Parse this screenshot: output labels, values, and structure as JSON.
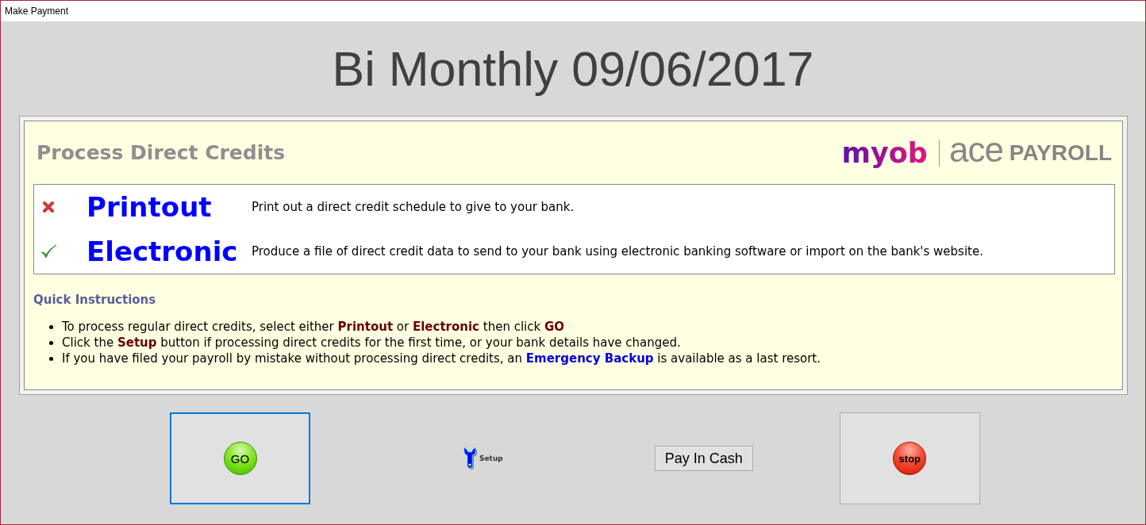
{
  "window": {
    "title": "Make Payment"
  },
  "heading": "Bi Monthly 09/06/2017",
  "panel": {
    "title": "Process Direct Credits",
    "logo": {
      "brand": "myob",
      "product": "ace",
      "product_suffix": "PAYROLL"
    },
    "options": [
      {
        "label": "Printout",
        "description": "Print out a direct credit schedule to give to your bank.",
        "checked": false
      },
      {
        "label": "Electronic",
        "description": "Produce a file of direct credit data to send to your bank using electronic banking software or import on the bank's website.",
        "checked": true
      }
    ],
    "instructions": {
      "title": "Quick Instructions",
      "items": [
        [
          {
            "text": "To process regular direct credits, select either ",
            "kind": "text"
          },
          {
            "text": "Printout",
            "kind": "keyword"
          },
          {
            "text": " or ",
            "kind": "text"
          },
          {
            "text": "Electronic",
            "kind": "keyword"
          },
          {
            "text": " then click ",
            "kind": "text"
          },
          {
            "text": "GO",
            "kind": "keyword"
          }
        ],
        [
          {
            "text": "Click the ",
            "kind": "text"
          },
          {
            "text": "Setup",
            "kind": "keyword"
          },
          {
            "text": " button if processing direct credits for the first time, or your bank details have changed.",
            "kind": "text"
          }
        ],
        [
          {
            "text": "If you have filed your payroll by mistake without processing direct credits, an ",
            "kind": "text"
          },
          {
            "text": "Emergency Backup",
            "kind": "link"
          },
          {
            "text": " is available as a last resort.",
            "kind": "text"
          }
        ]
      ]
    }
  },
  "buttons": [
    {
      "kind": "go",
      "label": "GO",
      "focused": true
    },
    {
      "kind": "setup",
      "label": "Setup",
      "focused": false
    },
    {
      "kind": "cash",
      "label": "Pay In Cash",
      "focused": false
    },
    {
      "kind": "stop",
      "label": "stop",
      "focused": false
    }
  ]
}
